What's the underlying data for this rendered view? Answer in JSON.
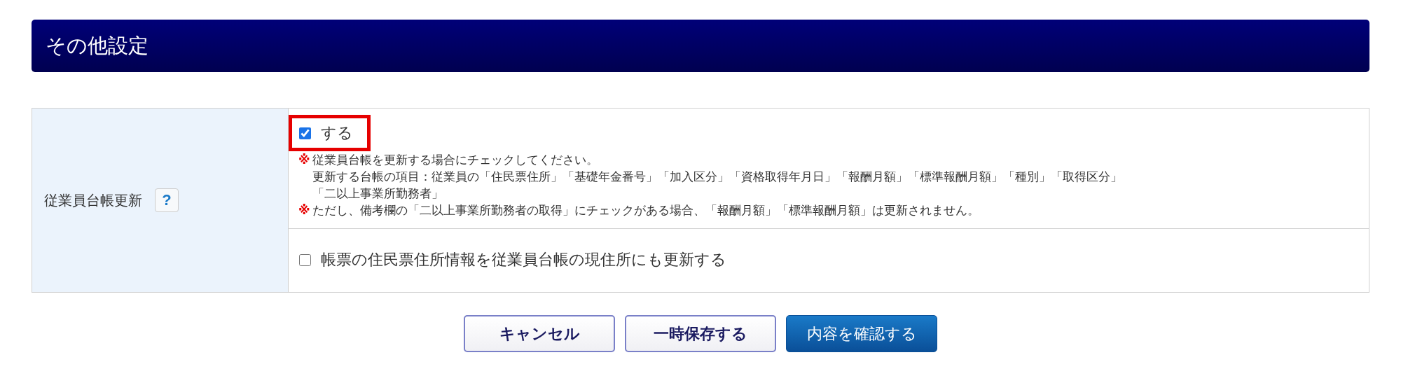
{
  "section_title": "その他設定",
  "setting": {
    "label": "従業員台帳更新",
    "help": "?",
    "options": [
      {
        "label": "する",
        "checked": true,
        "highlighted": true,
        "notes": [
          {
            "mark": "※",
            "text": "従業員台帳を更新する場合にチェックしてください。"
          },
          {
            "text": "更新する台帳の項目：従業員の「住民票住所」「基礎年金番号」「加入区分」「資格取得年月日」「報酬月額」「標準報酬月額」「種別」「取得区分」"
          },
          {
            "text": "「二以上事業所勤務者」"
          },
          {
            "mark": "※",
            "text": "ただし、備考欄の「二以上事業所勤務者の取得」にチェックがある場合、「報酬月額」「標準報酬月額」は更新されません。"
          }
        ]
      },
      {
        "label": "帳票の住民票住所情報を従業員台帳の現住所にも更新する",
        "checked": false,
        "highlighted": false
      }
    ]
  },
  "buttons": [
    {
      "label": "キャンセル",
      "kind": "secondary"
    },
    {
      "label": "一時保存する",
      "kind": "secondary"
    },
    {
      "label": "内容を確認する",
      "kind": "primary"
    }
  ]
}
